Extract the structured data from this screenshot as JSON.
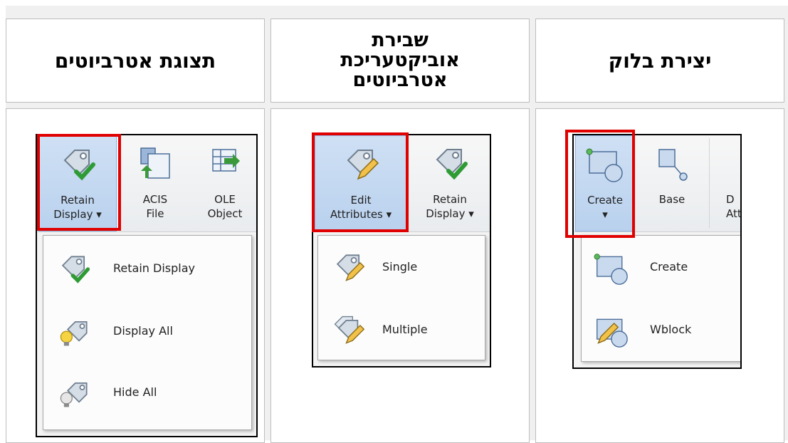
{
  "headers": {
    "col_left": [
      "תצוגת אטרביוטים"
    ],
    "col_middle": [
      "שבירת",
      "אוביקטעריכת",
      "אטרביוטים"
    ],
    "col_right": [
      "יצירת בלוק"
    ]
  },
  "panel_left": {
    "ribbon": {
      "retain_display": [
        "Retain",
        "Display ▾"
      ],
      "acis_file": [
        "ACIS",
        "File"
      ],
      "ole_object": [
        "OLE",
        "Object"
      ]
    },
    "menu": [
      "Retain Display",
      "Display All",
      "Hide All"
    ]
  },
  "panel_middle": {
    "ribbon": {
      "edit_attributes": [
        "Edit",
        "Attributes ▾"
      ],
      "retain_display": [
        "Retain",
        "Display ▾"
      ]
    },
    "menu": [
      "Single",
      "Multiple"
    ]
  },
  "panel_right": {
    "ribbon": {
      "create": [
        "Create",
        "▾"
      ],
      "base": [
        "Base",
        ""
      ],
      "define_attributes_partial": [
        "D",
        "Att"
      ]
    },
    "menu": [
      "Create",
      "Wblock"
    ]
  },
  "colors": {
    "highlight_box": "#e00000",
    "ribbon_selected": "#b9d1ee",
    "cell_border": "#bdbdbd"
  },
  "icons": [
    "tag-check-icon",
    "acis-file-icon",
    "ole-object-icon",
    "tag-pencil-icon",
    "tag-bulb-icon",
    "tag-bulb-off-icon",
    "create-block-icon",
    "base-point-icon",
    "wblock-icon"
  ]
}
